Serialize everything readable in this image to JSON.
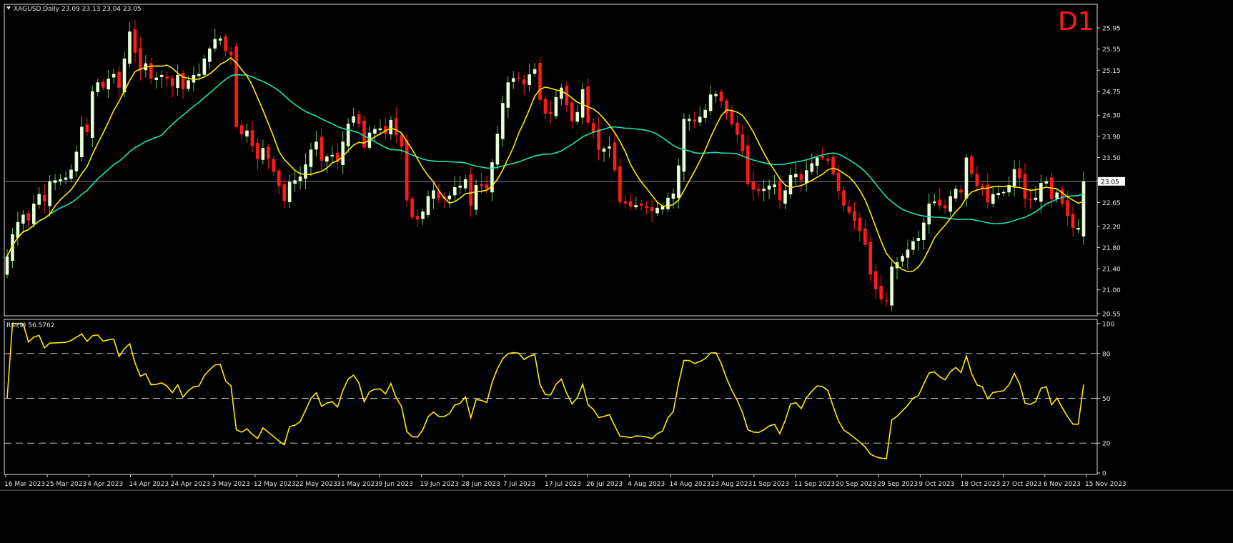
{
  "header": {
    "symbol_timeframe": "XAGUSD,Daily",
    "ohlc": "23.09 23.13 23.04 23.05",
    "timeframe_badge": "D1",
    "current_price_label": "23.05"
  },
  "rsi": {
    "label": "RSI(9) 56.5762"
  },
  "colors": {
    "background": "#000000",
    "frame": "#d8d8d8",
    "text": "#e6e6e6",
    "bull": "#e6ffd6",
    "bear": "#ff1a1a",
    "wick_bull": "#61c957",
    "wick_bear": "#ff1a1a",
    "ma_fast": "#ffeb00",
    "ma_slow": "#17e3b0",
    "rsi_line": "#ffeb00",
    "badge": "#ff1a1a"
  },
  "chart_data": [
    {
      "type": "candlestick",
      "series": [
        {
          "name": "XAGUSD,Daily"
        }
      ],
      "x_labels": [
        "16 Mar 2023",
        "25 Mar 2023",
        "4 Apr 2023",
        "14 Apr 2023",
        "24 Apr 2023",
        "3 May 2023",
        "12 May 2023",
        "22 May 2023",
        "31 May 2023",
        "9 Jun 2023",
        "19 Jun 2023",
        "28 Jun 2023",
        "7 Jul 2023",
        "17 Jul 2023",
        "26 Jul 2023",
        "4 Aug 2023",
        "14 Aug 2023",
        "23 Aug 2023",
        "1 Sep 2023",
        "11 Sep 2023",
        "20 Sep 2023",
        "29 Sep 2023",
        "9 Oct 2023",
        "18 Oct 2023",
        "27 Oct 2023",
        "6 Nov 2023",
        "15 Nov 2023"
      ],
      "y_ticks": [
        "25.95",
        "25.55",
        "25.15",
        "24.75",
        "24.30",
        "23.90",
        "23.50",
        "23.05",
        "22.65",
        "22.20",
        "21.80",
        "21.40",
        "21.00",
        "20.55"
      ],
      "ylim": [
        20.55,
        26.2
      ],
      "current_price": 23.05,
      "closes": [
        21.63,
        22.05,
        22.28,
        22.42,
        22.31,
        22.63,
        22.81,
        22.67,
        23.05,
        23.07,
        23.09,
        23.12,
        23.27,
        23.61,
        24.08,
        23.98,
        24.75,
        24.92,
        24.82,
        24.99,
        25.08,
        24.82,
        25.37,
        25.88,
        25.48,
        25.15,
        25.28,
        24.99,
        25.01,
        25.06,
        24.99,
        24.85,
        25.06,
        24.79,
        24.96,
        25.06,
        25.08,
        25.37,
        25.56,
        25.74,
        25.75,
        25.51,
        25.43,
        24.08,
        23.94,
        24.01,
        23.72,
        23.47,
        23.68,
        23.47,
        23.23,
        22.96,
        22.68,
        23.04,
        23.07,
        23.14,
        23.37,
        23.65,
        23.8,
        23.44,
        23.52,
        23.55,
        23.42,
        23.8,
        24.14,
        24.28,
        24.13,
        23.69,
        23.97,
        24.04,
        24.05,
        23.95,
        24.21,
        23.92,
        23.7,
        22.69,
        22.37,
        22.33,
        22.48,
        22.77,
        22.88,
        22.73,
        22.72,
        22.78,
        22.94,
        22.97,
        23.09,
        22.59,
        22.98,
        22.96,
        22.91,
        23.41,
        23.95,
        24.53,
        24.92,
        25.0,
        24.99,
        24.88,
        25.07,
        25.17,
        24.59,
        24.33,
        24.32,
        24.64,
        24.82,
        24.49,
        24.19,
        24.36,
        24.79,
        24.16,
        23.98,
        23.64,
        23.67,
        23.71,
        23.26,
        22.66,
        22.63,
        22.57,
        22.6,
        22.59,
        22.55,
        22.49,
        22.55,
        22.58,
        22.74,
        22.82,
        23.35,
        24.23,
        24.23,
        24.18,
        24.27,
        24.4,
        24.69,
        24.7,
        24.56,
        24.34,
        24.13,
        23.93,
        23.62,
        23.0,
        22.89,
        22.87,
        22.91,
        22.97,
        22.99,
        22.69,
        22.88,
        23.17,
        23.19,
        23.07,
        23.26,
        23.39,
        23.5,
        23.49,
        23.44,
        23.19,
        22.87,
        22.59,
        22.46,
        22.3,
        22.11,
        21.85,
        21.29,
        21.01,
        20.82,
        20.78,
        21.44,
        21.52,
        21.64,
        21.76,
        21.92,
        21.98,
        22.27,
        22.63,
        22.67,
        22.59,
        22.54,
        22.77,
        22.91,
        22.84,
        23.5,
        23.19,
        22.96,
        22.92,
        22.65,
        22.81,
        22.83,
        22.85,
        22.98,
        23.28,
        23.11,
        22.72,
        22.69,
        22.74,
        23.02,
        23.05,
        22.71,
        22.84,
        22.63,
        22.4,
        22.17,
        22.17,
        23.05
      ],
      "ma_fast_closes": "derived",
      "ma_slow_closes": "derived"
    },
    {
      "type": "line",
      "series": [
        {
          "name": "RSI(9)",
          "last_value": 56.5762
        }
      ],
      "y_ticks": [
        "100",
        "80",
        "50",
        "20",
        "0"
      ],
      "ylim": [
        0,
        100
      ],
      "levels": [
        80,
        50,
        20
      ]
    }
  ]
}
